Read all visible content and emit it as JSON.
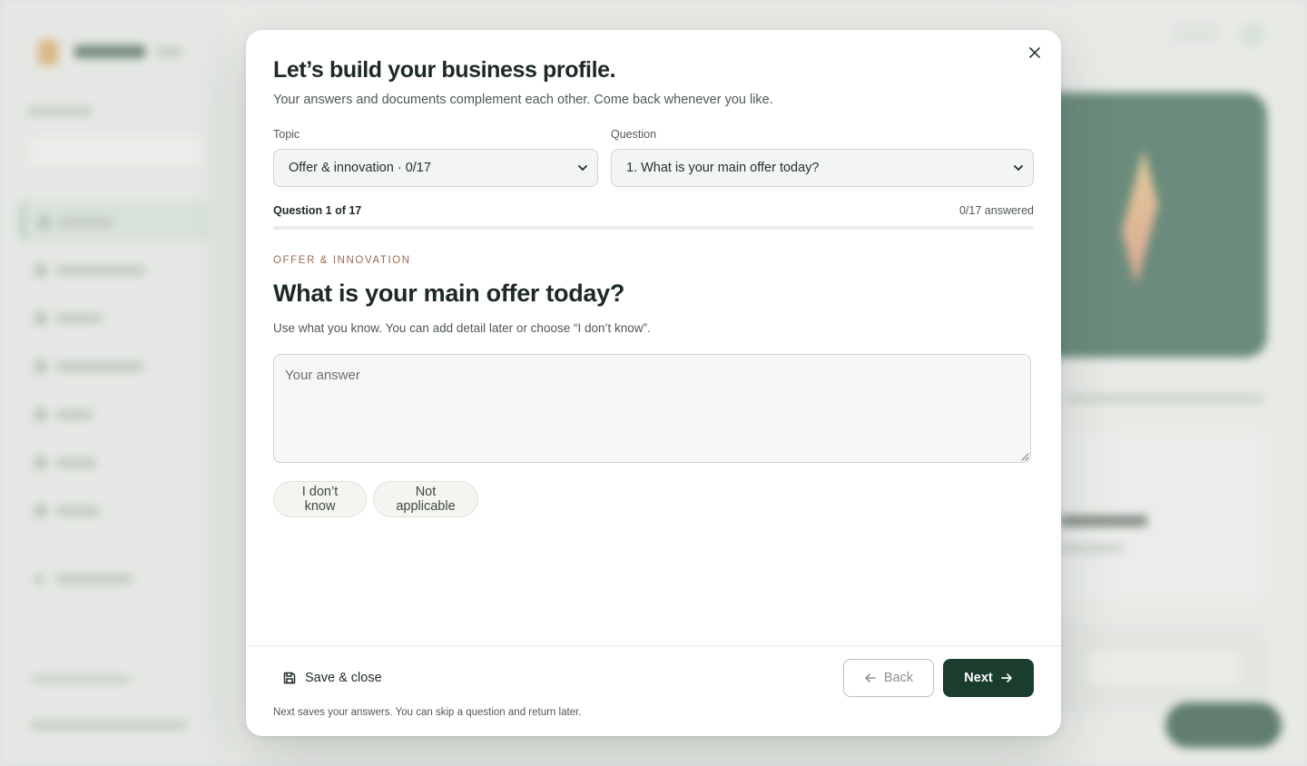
{
  "modal": {
    "title": "Let’s build your business profile.",
    "subtitle": "Your answers and documents complement each other. Come back whenever you like."
  },
  "topic": {
    "label": "Topic",
    "selected": "Offer & innovation · 0/17"
  },
  "question_select": {
    "label": "Question",
    "selected": "1. What is your main offer today?"
  },
  "progress": {
    "label": "Question 1 of 17",
    "answered": "0/17 answered",
    "fraction": 0
  },
  "question": {
    "kicker": "OFFER & INNOVATION",
    "title": "What is your main offer today?",
    "help": "Use what you know. You can add detail later or choose “I don’t know”.",
    "answer_placeholder": "Your answer",
    "answer_value": ""
  },
  "quick_answers": {
    "dont_know": "I don’t know",
    "not_applicable": "Not applicable"
  },
  "footer": {
    "save_close": "Save & close",
    "back": "Back",
    "next": "Next",
    "note": "Next saves your answers. You can skip a question and return later."
  },
  "colors": {
    "primary": "#1b3d2e",
    "accent_kicker": "#9a6b4f",
    "field_bg": "#f3f5f2"
  },
  "icons": {
    "close": "close-icon",
    "chevron": "chevron-down-icon",
    "save": "save-icon",
    "back": "arrow-left-icon",
    "next": "arrow-right-icon"
  }
}
